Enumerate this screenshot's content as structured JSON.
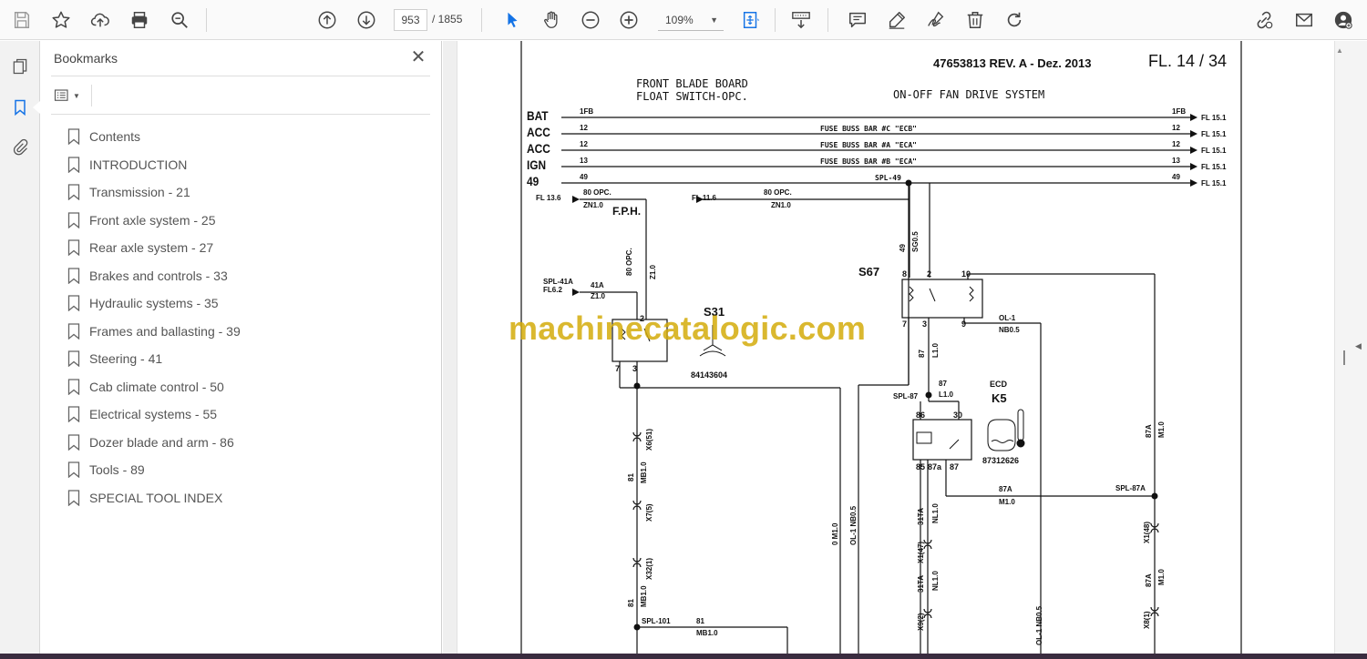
{
  "toolbar": {
    "current_page": "953",
    "total_pages": "/ 1855",
    "zoom": "109%",
    "icons": [
      "save-icon",
      "bookmark-star-icon",
      "upload-icon",
      "print-icon",
      "zoom-search-icon",
      "prev-page-icon",
      "next-page-icon",
      "select-cursor-icon",
      "hand-icon",
      "zoom-out-icon",
      "zoom-in-icon",
      "fit-page-icon",
      "scroll-mode-icon",
      "comment-icon",
      "highlight-pen-icon",
      "sign-icon",
      "delete-icon",
      "rotate-icon",
      "link-share-icon",
      "email-icon",
      "account-icon"
    ]
  },
  "rail": {
    "icons": [
      "pages-icon",
      "bookmarks-icon",
      "attachments-icon"
    ]
  },
  "bookmarks": {
    "title": "Bookmarks",
    "items": [
      {
        "label": "Contents"
      },
      {
        "label": "INTRODUCTION"
      },
      {
        "label": "Transmission - 21"
      },
      {
        "label": "Front axle system - 25"
      },
      {
        "label": "Rear axle system - 27"
      },
      {
        "label": "Brakes and controls - 33"
      },
      {
        "label": "Hydraulic systems - 35"
      },
      {
        "label": "Frames and ballasting - 39"
      },
      {
        "label": "Steering - 41"
      },
      {
        "label": "Cab climate control - 50"
      },
      {
        "label": "Electrical systems - 55"
      },
      {
        "label": "Dozer blade and arm - 86"
      },
      {
        "label": "Tools - 89"
      },
      {
        "label": "SPECIAL TOOL INDEX"
      }
    ]
  },
  "document": {
    "doc_ref": "47653813 REV. A - Dez. 2013",
    "sheet": "FL. 14 / 34",
    "heading_left_1": "FRONT BLADE BOARD",
    "heading_left_2": "FLOAT SWITCH-OPC.",
    "heading_right": "ON-OFF FAN DRIVE SYSTEM",
    "bus_labels": [
      "BAT",
      "ACC",
      "ACC",
      "IGN",
      "49"
    ],
    "bus_wires": [
      "1FB",
      "12",
      "12",
      "13",
      "49"
    ],
    "bus_wires_end": [
      "1FB",
      "12",
      "12",
      "13",
      "49"
    ],
    "bus_desc": [
      "",
      "FUSE BUSS BAR #C \"ECB\"",
      "FUSE BUSS BAR #A \"ECA\"",
      "FUSE BUSS BAR #B \"ECA\"",
      "SPL-49"
    ],
    "bus_refs": [
      "FL 15.1",
      "FL 15.1",
      "FL 15.1",
      "FL 15.1",
      "FL 15.1"
    ],
    "fl136": "FL 13.6",
    "fl136_wire": "80 OPC.",
    "fl136_zn": "ZN1.0",
    "fph": "F.P.H.",
    "fl116": "FL 11.6",
    "fl116_wire": "80 OPC.",
    "fl116_zn": "ZN1.0",
    "spl41a": "SPL-41A",
    "fl62": "FL6.2",
    "w41a": "41A",
    "z10a": "Z1.0",
    "w80opc": "80 OPC.",
    "z10b": "Z1.0",
    "s31": "S31",
    "s31_num": "84143604",
    "s67": "S67",
    "w49v": "49",
    "sg05": "SG0.5",
    "ol1": "OL-1",
    "nb05": "NB0.5",
    "w87": "87",
    "l10": "L1.0",
    "spl87": "SPL-87",
    "w87b": "87",
    "l10b": "L1.0",
    "ecd": "ECD",
    "k5": "K5",
    "k5_num": "87312626",
    "w87a": "87A",
    "m10": "M1.0",
    "spl87a": "SPL-87A",
    "w87a_v": "87A",
    "m10_v": "M1.0",
    "x6": "X6(51)",
    "w81": "81",
    "mb10": "MB1.0",
    "x7": "X7(5)",
    "x32": "X32(1)",
    "w81b": "81",
    "mb10b": "MB1.0",
    "spl101": "SPL-101",
    "w81c": "81",
    "mb10c": "MB1.0",
    "w0m10": "0 M1.0",
    "ol1nb": "OL-1 NB0.5",
    "w31ta": "31TA",
    "nl10": "NL1.0",
    "x1_47": "X1(47)",
    "w31ta2": "31TA",
    "nl10b": "NL1.0",
    "x9_2": "X9(2)",
    "ol1nb2": "OL-1 NB0.5",
    "x1_48": "X1(48)",
    "w87a2": "87A",
    "m10b": "M1.0",
    "x8_1": "X8(1)",
    "pin_labels": [
      "8",
      "2",
      "10",
      "7",
      "3",
      "9",
      "2",
      "7",
      "3",
      "86",
      "30",
      "85",
      "87a",
      "87"
    ],
    "watermark": "machinecatalogic.com"
  }
}
